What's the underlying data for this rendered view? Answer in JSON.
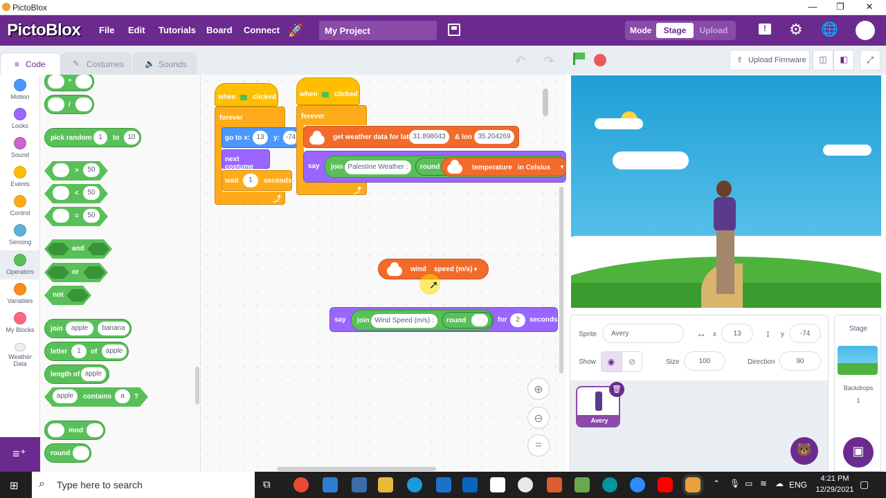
{
  "window": {
    "title": "PictoBlox"
  },
  "menu": {
    "logo": "PictoBlox",
    "items": [
      "File",
      "Edit",
      "Tutorials",
      "Board",
      "Connect"
    ],
    "project_name": "My Project",
    "mode_label": "Mode",
    "mode_stage": "Stage",
    "mode_upload": "Upload"
  },
  "tabs": {
    "code": "Code",
    "costumes": "Costumes",
    "sounds": "Sounds"
  },
  "categories": [
    {
      "label": "Motion",
      "color": "#4c97ff"
    },
    {
      "label": "Looks",
      "color": "#9966ff"
    },
    {
      "label": "Sound",
      "color": "#cf63cf"
    },
    {
      "label": "Events",
      "color": "#ffbf00"
    },
    {
      "label": "Control",
      "color": "#ffab19"
    },
    {
      "label": "Sensing",
      "color": "#5cb1d6"
    },
    {
      "label": "Operators",
      "color": "#59c059"
    },
    {
      "label": "Variables",
      "color": "#ff8c1a"
    },
    {
      "label": "My Blocks",
      "color": "#ff6680"
    },
    {
      "label": "Weather Data",
      "color": "#e0e0e0"
    }
  ],
  "palette": {
    "mul": "*",
    "div": "/",
    "pick_random": "pick random",
    "pick_from": "1",
    "pick_to_label": "to",
    "pick_to": "10",
    "gt": ">",
    "lt": "<",
    "eq": "=",
    "cmp_val": "50",
    "and": "and",
    "or": "or",
    "not": "not",
    "join": "join",
    "join_a": "apple",
    "join_b": "banana",
    "letter": "letter",
    "letter_n": "1",
    "letter_of": "of",
    "letter_word": "apple",
    "length_of": "length of",
    "length_word": "apple",
    "contains_word": "apple",
    "contains": "contains",
    "contains_char": "a",
    "contains_q": "?",
    "mod": "mod",
    "round": "round"
  },
  "script1": {
    "when": "when",
    "clicked": "clicked",
    "forever": "forever",
    "goto": "go to x:",
    "x": "13",
    "y_label": "y:",
    "y": "-74",
    "next_costume": "next costume",
    "wait": "wait",
    "wait_val": "1",
    "seconds": "seconds"
  },
  "script2": {
    "when": "when",
    "clicked": "clicked",
    "forever": "forever",
    "get_weather": "get weather data for lat",
    "lat": "31.898043",
    "lon_label": "& lon",
    "lon": "35.204269",
    "say": "say",
    "join": "join",
    "join_text": "Palestine Weather :",
    "round": "round",
    "temperature": "temperature",
    "unit": "in Celsius"
  },
  "loose_wind": {
    "wind": "wind",
    "speed": "speed (m/s)"
  },
  "loose_say": {
    "say": "say",
    "join": "join",
    "text": "Wind Speed (m/s) :",
    "round": "round",
    "for": "for",
    "secs": "2",
    "seconds": "seconds"
  },
  "stage_header": {
    "upload_firmware": "Upload Firmware"
  },
  "sprite": {
    "label": "Sprite",
    "name": "Avery",
    "x_label": "x",
    "x": "13",
    "y_label": "y",
    "y": "-74",
    "show_label": "Show",
    "size_label": "Size",
    "size": "100",
    "direction_label": "Direction",
    "direction": "90",
    "thumb_name": "Avery"
  },
  "stage_panel": {
    "title": "Stage",
    "backdrops": "Backdrops",
    "count": "1"
  },
  "taskbar": {
    "search_placeholder": "Type here to search",
    "lang": "ENG",
    "time": "4:21 PM",
    "date": "12/29/2021"
  }
}
